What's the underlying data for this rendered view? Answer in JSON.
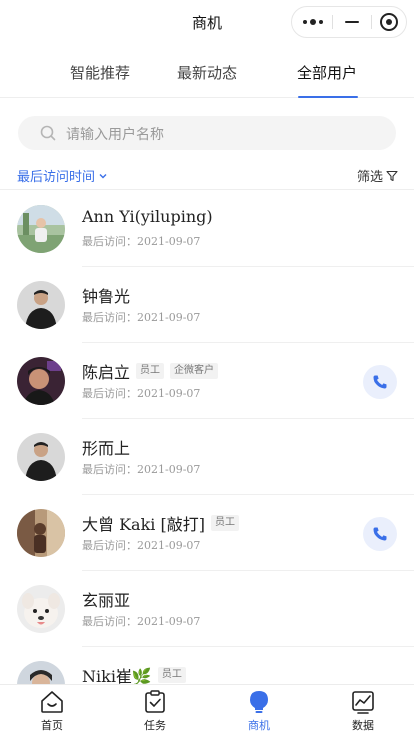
{
  "header": {
    "title": "商机"
  },
  "tabs": [
    {
      "label": "智能推荐"
    },
    {
      "label": "最新动态"
    },
    {
      "label": "全部用户"
    }
  ],
  "active_tab": 2,
  "search": {
    "placeholder": "请输入用户名称"
  },
  "filters": {
    "sort_label": "最后访问时间",
    "filter_label": "筛选"
  },
  "users": [
    {
      "name": "Ann Yi(yiluping)",
      "tags": [],
      "visit_label": "最后访问：",
      "visit_date": "2021-09-07",
      "has_phone": false
    },
    {
      "name": "钟鲁光",
      "tags": [],
      "visit_label": "最后访问：",
      "visit_date": "2021-09-07",
      "has_phone": false
    },
    {
      "name": "陈启立",
      "tags": [
        "员工",
        "企微客户"
      ],
      "visit_label": "最后访问：",
      "visit_date": "2021-09-07",
      "has_phone": true
    },
    {
      "name": "形而上",
      "tags": [],
      "visit_label": "最后访问：",
      "visit_date": "2021-09-07",
      "has_phone": false
    },
    {
      "name": "大曾 Kaki [敲打]",
      "tags": [
        "员工"
      ],
      "visit_label": "最后访问：",
      "visit_date": "2021-09-07",
      "has_phone": true
    },
    {
      "name": "玄丽亚",
      "tags": [],
      "visit_label": "最后访问：",
      "visit_date": "2021-09-07",
      "has_phone": false
    },
    {
      "name": "Niki崔🌿",
      "tags": [
        "员工"
      ],
      "visit_label": "",
      "visit_date": "",
      "has_phone": false
    }
  ],
  "bottom_nav": [
    {
      "label": "首页",
      "icon": "home-icon"
    },
    {
      "label": "任务",
      "icon": "task-icon"
    },
    {
      "label": "商机",
      "icon": "opportunity-icon"
    },
    {
      "label": "数据",
      "icon": "data-chart-icon"
    }
  ],
  "active_nav": 2,
  "colors": {
    "accent": "#3a6fe8",
    "phone_bg": "#eaeffc"
  }
}
